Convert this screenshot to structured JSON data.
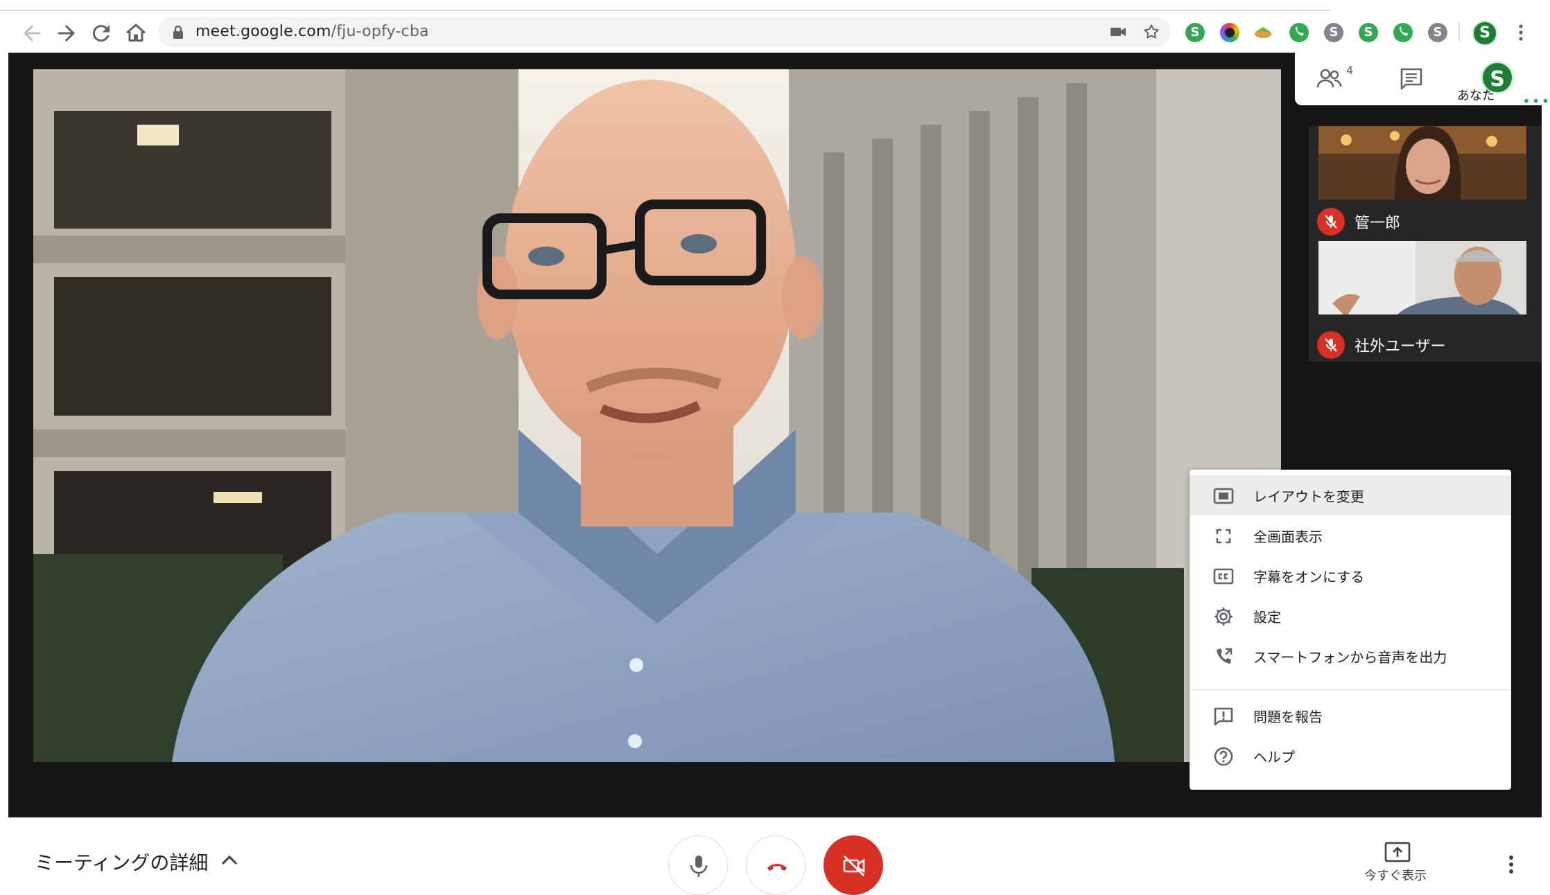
{
  "browser": {
    "url_host": "meet.google.com",
    "url_path": "/fju-opfy-cba",
    "extensions": [
      "green-s-extension",
      "color-ring-extension",
      "sandwich-extension",
      "green-phone-extension",
      "grey-s-extension",
      "green-s-extension",
      "green-phone-extension",
      "grey-s-extension"
    ]
  },
  "panel": {
    "people_count": "4",
    "self_initial": "S",
    "self_label": "あなた"
  },
  "participants": [
    {
      "name": "管一郎",
      "muted": true
    },
    {
      "name": "社外ユーザー",
      "muted": true
    }
  ],
  "menu": {
    "items": [
      {
        "icon": "layout-icon",
        "label": "レイアウトを変更"
      },
      {
        "icon": "fullscreen-icon",
        "label": "全画面表示"
      },
      {
        "icon": "captions-icon",
        "label": "字幕をオンにする"
      },
      {
        "icon": "settings-gear-icon",
        "label": "設定"
      },
      {
        "icon": "phone-audio-icon",
        "label": "スマートフォンから音声を出力"
      },
      {
        "icon": "report-problem-icon",
        "label": "問題を報告"
      },
      {
        "icon": "help-icon",
        "label": "ヘルプ"
      }
    ]
  },
  "bottom": {
    "details_label": "ミーティングの詳細",
    "present_label": "今すぐ表示"
  },
  "colors": {
    "danger": "#d93025",
    "brand_green": "#34a853",
    "stage": "#161616"
  }
}
